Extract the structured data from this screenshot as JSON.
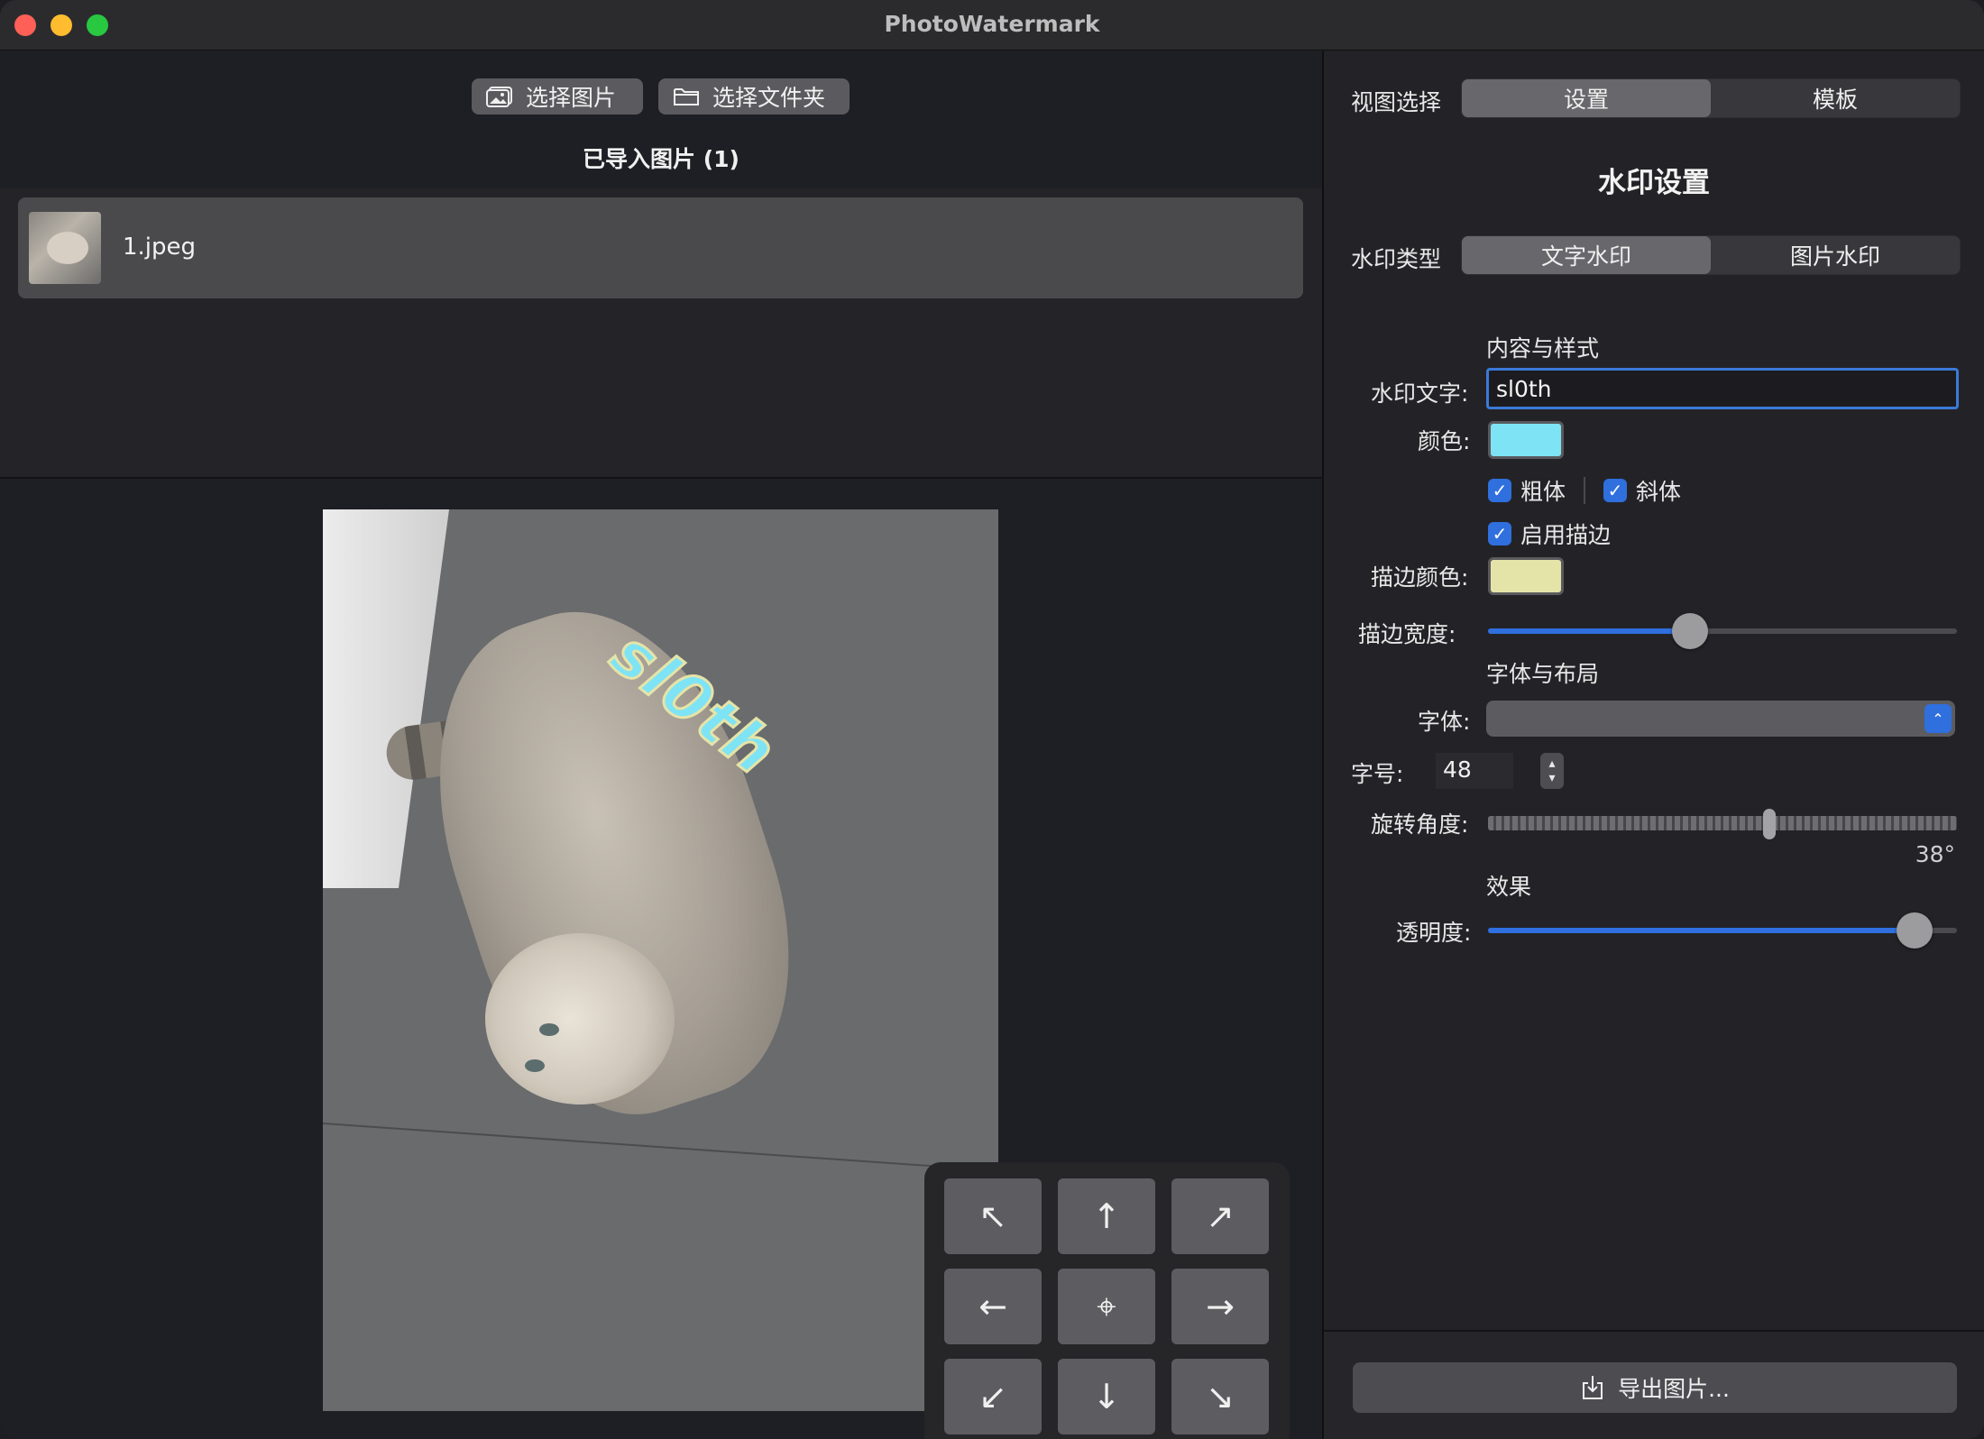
{
  "window": {
    "title": "PhotoWatermark"
  },
  "toolbar": {
    "select_image_label": "选择图片",
    "select_folder_label": "选择文件夹"
  },
  "import_list": {
    "title": "已导入图片 (1)",
    "items": [
      {
        "name": "1.jpeg"
      }
    ]
  },
  "preview": {
    "watermark_text": "sl0th",
    "position_pad": [
      "↖",
      "↑",
      "↗",
      "←",
      "⌖",
      "→",
      "↙",
      "↓",
      "↘"
    ]
  },
  "view_select": {
    "label": "视图选择",
    "options": [
      "设置",
      "模板"
    ],
    "selected": "设置"
  },
  "settings": {
    "title": "水印设置",
    "type_label": "水印类型",
    "types": [
      "文字水印",
      "图片水印"
    ],
    "selected_type": "文字水印",
    "content_section": "内容与样式",
    "text_label": "水印文字:",
    "text_value": "sl0th",
    "color_label": "颜色:",
    "color_value": "#7ee3f5",
    "bold_label": "粗体",
    "italic_label": "斜体",
    "stroke_enable_label": "启用描边",
    "stroke_color_label": "描边颜色:",
    "stroke_color_value": "#e5e4a8",
    "stroke_width_label": "描边宽度:",
    "stroke_width_fraction": 0.43,
    "font_section": "字体与布局",
    "font_label": "字体:",
    "size_label": "字号:",
    "size_value": "48",
    "rotation_label": "旋转角度:",
    "rotation_value": "38°",
    "rotation_fraction": 0.6,
    "effects_section": "效果",
    "opacity_label": "透明度:",
    "opacity_fraction": 0.91
  },
  "export": {
    "label": "导出图片..."
  }
}
